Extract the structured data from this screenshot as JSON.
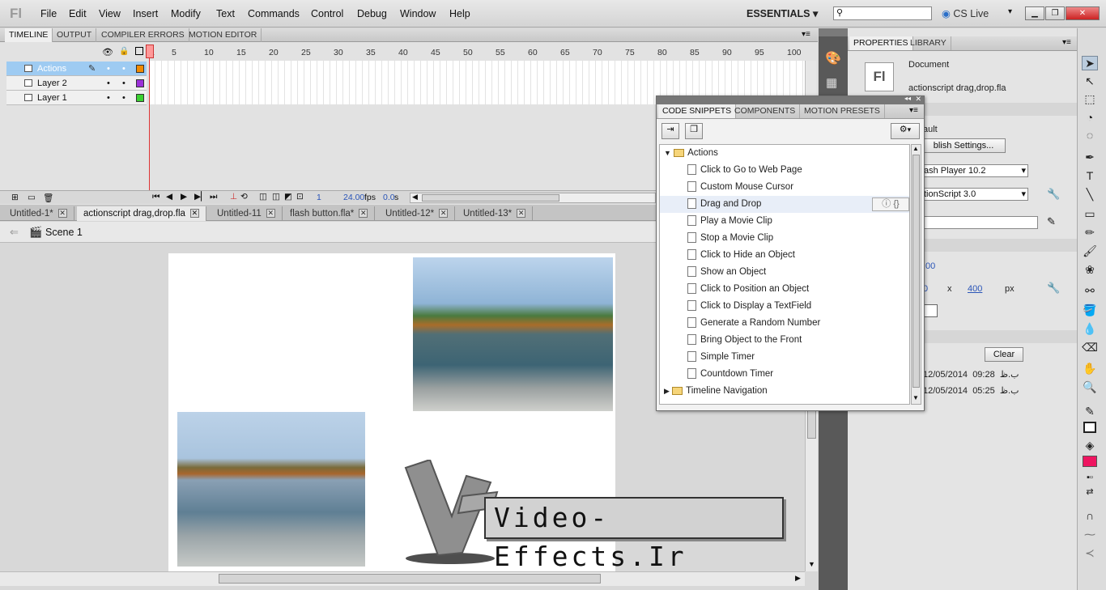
{
  "app": {
    "logo": "Fl",
    "menus": [
      "File",
      "Edit",
      "View",
      "Insert",
      "Modify",
      "Text",
      "Commands",
      "Control",
      "Debug",
      "Window",
      "Help"
    ],
    "workspace": "ESSENTIALS",
    "cs_live": "CS Live"
  },
  "timeline": {
    "tabs": [
      "TIMELINE",
      "OUTPUT",
      "COMPILER ERRORS",
      "MOTION EDITOR"
    ],
    "layers": [
      {
        "name": "Actions",
        "color": "#f28a00"
      },
      {
        "name": "Layer 2",
        "color": "#9b30d9"
      },
      {
        "name": "Layer 1",
        "color": "#3ad130"
      }
    ],
    "frame_numbers": [
      "1",
      "5",
      "10",
      "15",
      "20",
      "25",
      "30",
      "35",
      "40",
      "45",
      "50",
      "55",
      "60",
      "65",
      "70",
      "75",
      "80",
      "85",
      "90",
      "95",
      "100"
    ],
    "current_frame": "1",
    "fps": "24.00",
    "fps_unit": "fps",
    "time": "0.0",
    "time_unit": "s"
  },
  "doc_tabs": [
    "Untitled-1*",
    "actionscript drag,drop.fla",
    "Untitled-11",
    "flash button.fla*",
    "Untitled-12*",
    "Untitled-13*"
  ],
  "scene": "Scene 1",
  "watermark": "Video-Effects.Ir",
  "snippets": {
    "tabs": [
      "CODE SNIPPETS",
      "COMPONENTS",
      "MOTION PRESETS"
    ],
    "root": "Actions",
    "items": [
      "Click to Go to Web Page",
      "Custom Mouse Cursor",
      "Drag and Drop",
      "Play a Movie Clip",
      "Stop a Movie Clip",
      "Click to Hide an Object",
      "Show an Object",
      "Click to Position an Object",
      "Click to Display a TextField",
      "Generate a Random Number",
      "Bring Object to the Front",
      "Simple Timer",
      "Countdown Timer"
    ],
    "folder2": "Timeline Navigation",
    "highlighted": "Drag and Drop"
  },
  "properties": {
    "tabs": [
      "PROPERTIES",
      "LIBRARY"
    ],
    "type": "Document",
    "file": "actionscript drag,drop.fla",
    "profile": "ault",
    "publish_btn": "blish Settings...",
    "player": "ash Player 10.2",
    "script": "tionScript 3.0",
    "fps_val": ".00",
    "w_val": "0",
    "x_label": "x",
    "h_val": "400",
    "unit": "px",
    "clear_btn": "Clear",
    "history": [
      {
        "date": "12/05/2014",
        "time": "09:28",
        "suffix": "ب.ظ"
      },
      {
        "date": "12/05/2014",
        "time": "05:25",
        "suffix": "ب.ظ"
      }
    ]
  }
}
